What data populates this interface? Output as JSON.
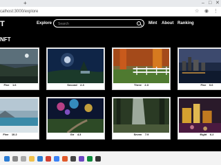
{
  "browser": {
    "url": "calhost:3000/explore",
    "new_tab": "+"
  },
  "nav": {
    "brand": "T",
    "explore": "Explore",
    "search_placeholder": "Search",
    "mint": "Mint",
    "about": "About",
    "ranking": "Ranking"
  },
  "section": {
    "title": "NFT"
  },
  "cards": [
    {
      "name": "Five",
      "price": "1.6"
    },
    {
      "name": "Second",
      "price": "2.3"
    },
    {
      "name": "Three",
      "price": "2.3"
    },
    {
      "name": "Five",
      "price": "0.6"
    },
    {
      "name": "Five",
      "price": "10.2"
    },
    {
      "name": "Gir",
      "price": "4.3"
    },
    {
      "name": "Seven",
      "price": "7.9"
    },
    {
      "name": "Eight",
      "price": "6.2"
    }
  ],
  "taskbar": {
    "time": "",
    "date": ""
  }
}
